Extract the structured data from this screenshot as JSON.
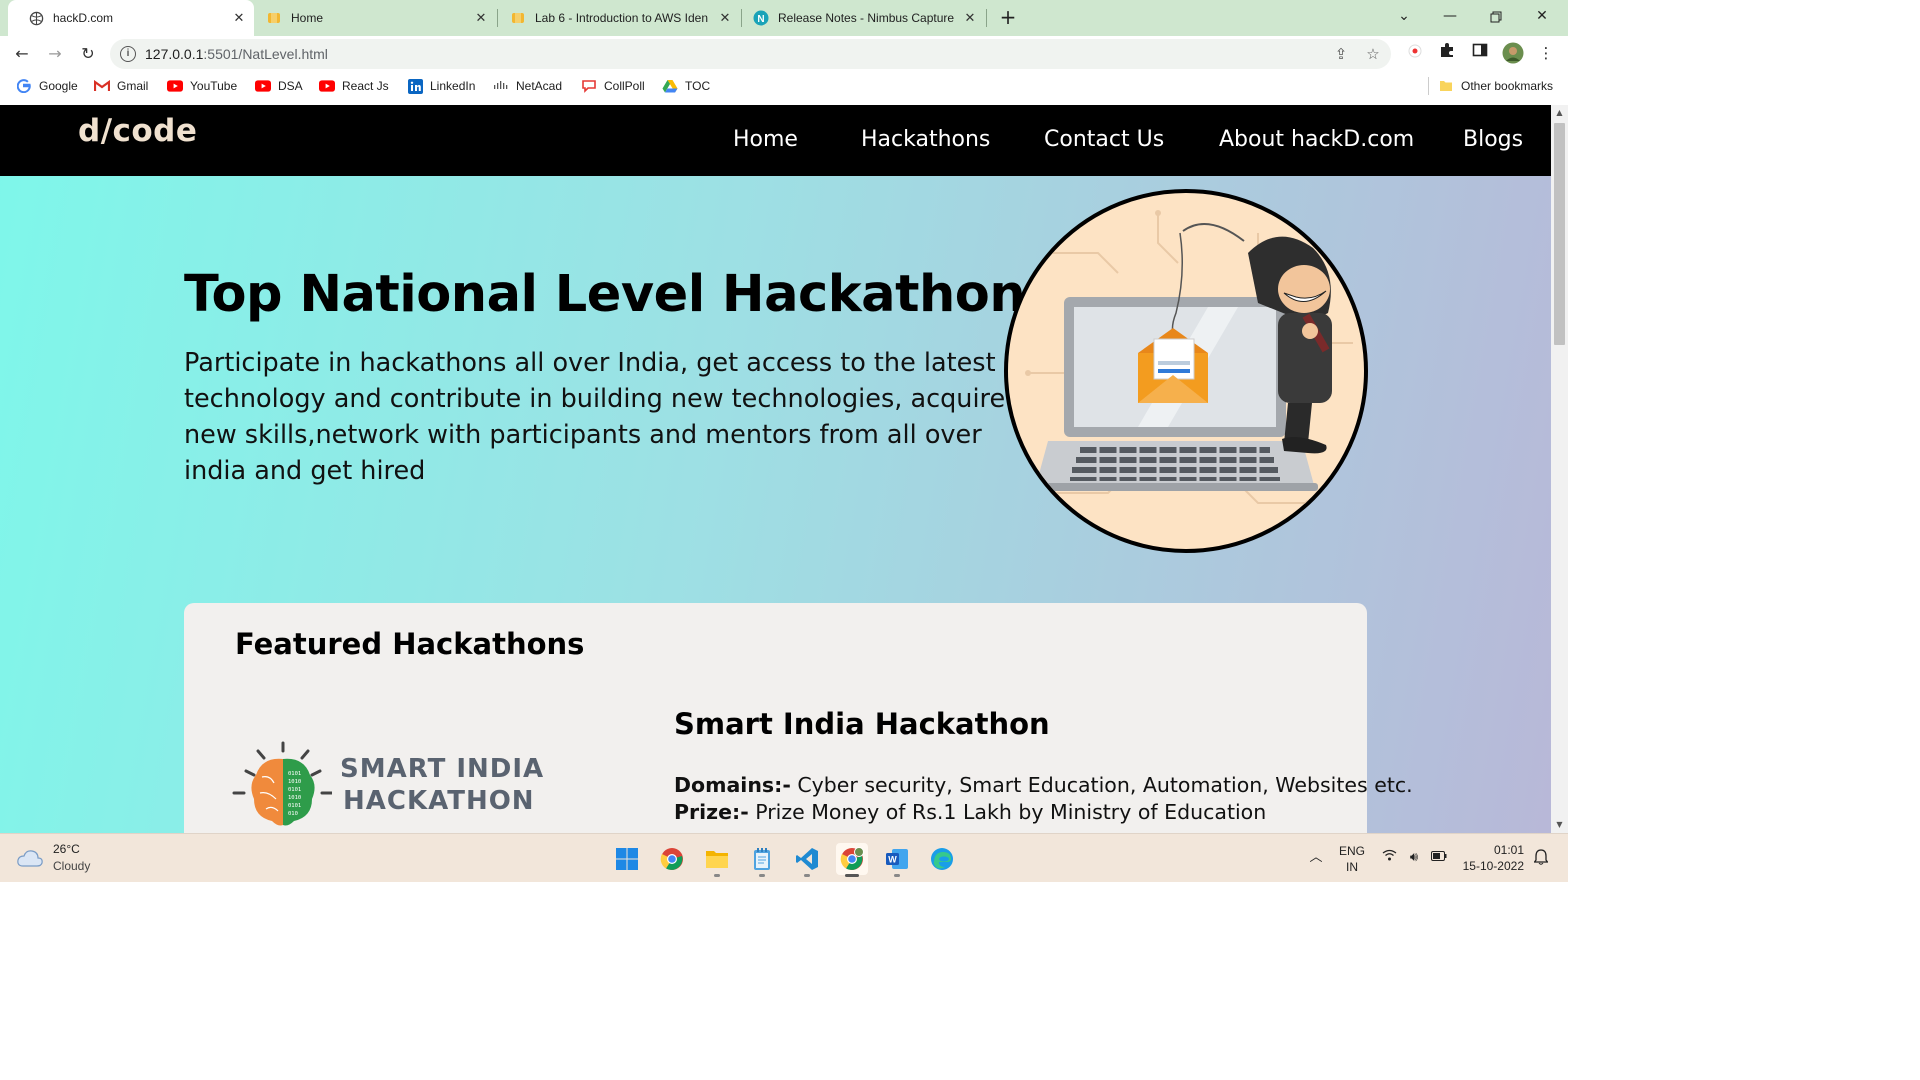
{
  "browser": {
    "tabs": [
      {
        "title": "hackD.com",
        "active": true,
        "icon": "globe-icon"
      },
      {
        "title": "Home",
        "active": false,
        "icon": "aws-cube-icon"
      },
      {
        "title": "Lab 6 - Introduction to AWS Iden",
        "active": false,
        "icon": "aws-cube-icon"
      },
      {
        "title": "Release Notes - Nimbus Capture",
        "active": false,
        "icon": "nimbus-icon"
      }
    ],
    "new_tab_symbol": "+",
    "url": {
      "host": "127.0.0.1",
      "rest": ":5501/NatLevel.html"
    },
    "bookmarks": [
      {
        "label": "Google",
        "icon": "google-icon"
      },
      {
        "label": "Gmail",
        "icon": "gmail-icon"
      },
      {
        "label": "YouTube",
        "icon": "youtube-icon"
      },
      {
        "label": "DSA",
        "icon": "youtube-icon"
      },
      {
        "label": "React Js",
        "icon": "youtube-icon"
      },
      {
        "label": "LinkedIn",
        "icon": "linkedin-icon"
      },
      {
        "label": "NetAcad",
        "icon": "cisco-icon"
      },
      {
        "label": "CollPoll",
        "icon": "chat-bubble-icon"
      },
      {
        "label": "TOC",
        "icon": "google-drive-icon"
      }
    ],
    "other_bookmarks": "Other bookmarks"
  },
  "site": {
    "logo": "d/code",
    "nav": [
      "Home",
      "Hackathons",
      "Contact Us",
      "About hackD.com",
      "Blogs"
    ],
    "hero": {
      "title": "Top National Level Hackathons",
      "text": "Participate in hackathons all over India, get access to the latest technology and contribute in building new technologies, acquire new skills,network with participants and mentors from all over india and get hired"
    },
    "featured": {
      "title": "Featured Hackathons",
      "logo_line1": "SMART INDIA",
      "logo_line2": "HACKATHON",
      "event": {
        "name": "Smart India Hackathon",
        "domains_label": "Domains:-",
        "domains": " Cyber security, Smart Education, Automation, Websites etc.",
        "prize_label": "Prize:-",
        "prize": " Prize Money of Rs.1 Lakh by Ministry of Education"
      }
    }
  },
  "taskbar": {
    "weather_temp": "26°C",
    "weather_desc": "Cloudy",
    "lang_top": "ENG",
    "lang_bottom": "IN",
    "time": "01:01",
    "date": "15-10-2022"
  },
  "colors": {
    "nav_bg": "#000000",
    "logo": "#f0e1cf",
    "gradient_start": "#7ef7ea",
    "gradient_end": "#b8b8d8",
    "card_bg": "#f2f0ee",
    "tabbar_bg": "#cfe7cf"
  }
}
